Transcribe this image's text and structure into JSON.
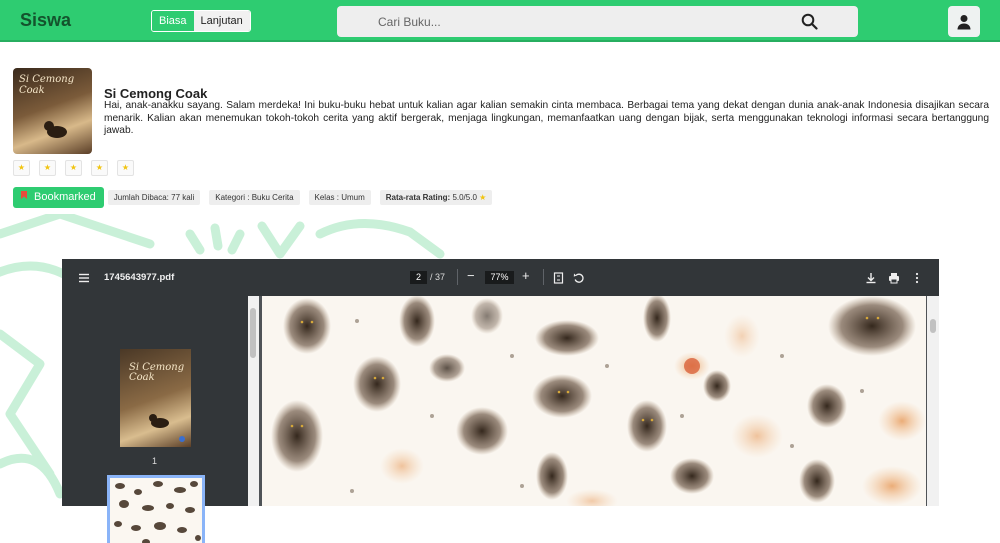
{
  "app": {
    "brand": "Siswa"
  },
  "mode_toggle": {
    "option_basic": "Biasa",
    "option_advanced": "Lanjutan",
    "selected": "Biasa"
  },
  "search": {
    "placeholder": "Cari Buku..."
  },
  "icons": {
    "search": "search-icon",
    "user": "user-icon",
    "bookmark": "bookmark-icon",
    "star": "star-icon"
  },
  "book": {
    "title": "Si Cemong Coak",
    "cover_text": "Si Cemong Coak",
    "description": "Hai, anak-anakku sayang. Salam merdeka! Ini buku-buku hebat untuk kalian agar kalian semakin cinta membaca. Berbagai tema yang dekat dengan dunia anak-anak Indonesia disajikan secara menarik. Kalian akan menemukan tokoh-tokoh cerita yang aktif bergerak, menjaga lingkungan, memanfaatkan uang dengan bijak, serta menggunakan teknologi informasi secara bertanggung jawab.",
    "rating_glyph": "★",
    "bookmark_label": "Bookmarked",
    "read_count": "Jumlah Dibaca: 77 kali",
    "category": "Kategori : Buku Cerita",
    "grade": "Kelas : Umum",
    "avg_rating_label": "Rata-rata Rating:",
    "avg_rating_value": "5.0/5.0"
  },
  "pdf_viewer": {
    "filename": "1745643977.pdf",
    "current_page": "2",
    "total_pages": "/ 37",
    "zoom": "77%",
    "zoom_out": "−",
    "zoom_in": "+",
    "thumbnail_1_label": "1"
  },
  "colors": {
    "accent": "#2ecc71",
    "accent_dark": "#27ae60",
    "viewer_bg": "#323639",
    "thumb_selected": "#8ab4f8"
  }
}
